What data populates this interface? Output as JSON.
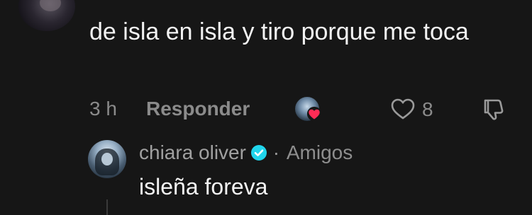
{
  "comment": {
    "text": "de isla en isla y tiro porque me toca",
    "time": "3 h",
    "reply_label": "Responder",
    "like_count": "8",
    "icons": {
      "like": "heart-outline-icon",
      "dislike": "thumbs-down-icon",
      "creator_liked": "red-heart-icon"
    }
  },
  "reply": {
    "username": "chiara oliver",
    "separator": "·",
    "relation": "Amigos",
    "text": "isleña foreva",
    "verified": true
  },
  "colors": {
    "background": "#161616",
    "primary_text": "#f3f3f3",
    "muted_text": "#8b8b8b",
    "verified_blue": "#20d5ec",
    "heart_red": "#fe2c55"
  }
}
